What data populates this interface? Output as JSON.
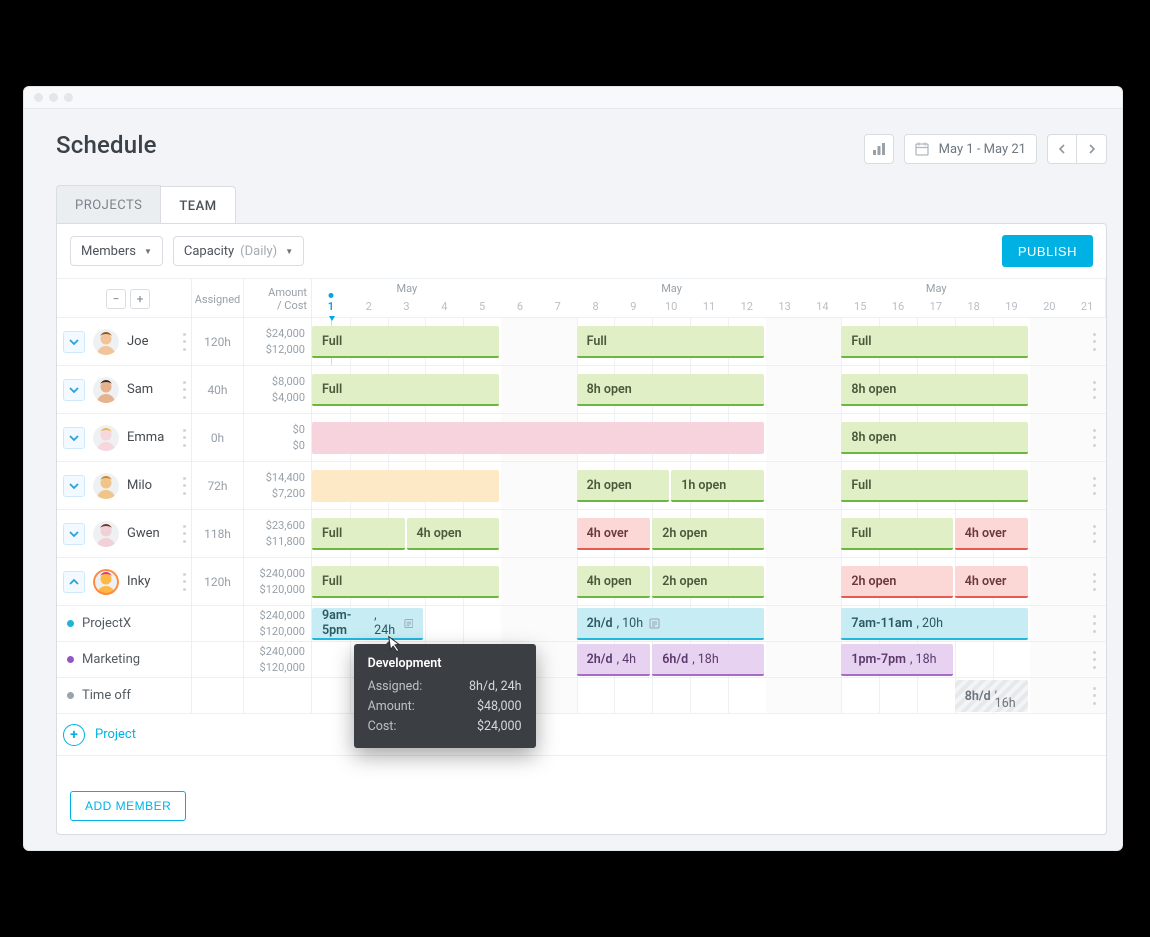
{
  "header": {
    "title": "Schedule"
  },
  "controls": {
    "date_range": "May 1 - May 21"
  },
  "tabs": {
    "projects": "PROJECTS",
    "team": "TEAM"
  },
  "filters": {
    "members_label": "Members",
    "capacity_label": "Capacity",
    "capacity_mode": "(Daily)"
  },
  "publish_label": "PUBLISH",
  "add_member_label": "ADD MEMBER",
  "add_project_label": "Project",
  "columns": {
    "assigned": "Assigned",
    "amount_cost": "Amount\n/ Cost"
  },
  "timeline": {
    "month_label": "May",
    "days": [
      1,
      2,
      3,
      4,
      5,
      6,
      7,
      8,
      9,
      10,
      11,
      12,
      13,
      14,
      15,
      16,
      17,
      18,
      19,
      20,
      21
    ],
    "today_index": 0
  },
  "members": [
    {
      "name": "Joe",
      "assigned": "120h",
      "amount": "$24,000",
      "cost": "$12,000",
      "expanded": false,
      "avatar": {
        "bg": "#f2c49a",
        "hair": "#8b5a2b"
      },
      "bars": [
        {
          "text": "Full",
          "style": "green",
          "week": 0,
          "span": 5
        },
        {
          "text": "Full",
          "style": "green",
          "week": 1,
          "span": 5
        },
        {
          "text": "Full",
          "style": "green",
          "week": 2,
          "span": 5
        }
      ]
    },
    {
      "name": "Sam",
      "assigned": "40h",
      "amount": "$8,000",
      "cost": "$4,000",
      "expanded": false,
      "avatar": {
        "bg": "#e7b28e",
        "hair": "#3a2c22"
      },
      "bars": [
        {
          "text": "Full",
          "style": "green",
          "week": 0,
          "span": 5
        },
        {
          "text": "8h open",
          "style": "green",
          "week": 1,
          "span": 5
        },
        {
          "text": "8h open",
          "style": "green",
          "week": 2,
          "span": 5
        }
      ]
    },
    {
      "name": "Emma",
      "assigned": "0h",
      "amount": "$0",
      "cost": "$0",
      "expanded": false,
      "avatar": {
        "bg": "#f7d6de",
        "hair": "#e9b94a"
      },
      "bars": [
        {
          "text": "",
          "style": "pink",
          "week": 0,
          "span": 12
        },
        {
          "text": "8h open",
          "style": "green",
          "week": 2,
          "span": 5
        }
      ]
    },
    {
      "name": "Milo",
      "assigned": "72h",
      "amount": "$14,400",
      "cost": "$7,200",
      "expanded": false,
      "avatar": {
        "bg": "#f0c58a",
        "hair": "#c8863a"
      },
      "bars": [
        {
          "text": "",
          "style": "yellow",
          "week": 0,
          "span": 5
        },
        {
          "text": "2h open",
          "style": "green",
          "week": 1,
          "span": 2.5
        },
        {
          "text": "1h open",
          "style": "green",
          "week": 1,
          "span": 2.5,
          "offset": 2.5
        },
        {
          "text": "Full",
          "style": "green",
          "week": 2,
          "span": 5
        }
      ]
    },
    {
      "name": "Gwen",
      "assigned": "118h",
      "amount": "$23,600",
      "cost": "$11,800",
      "expanded": false,
      "avatar": {
        "bg": "#f1d0d7",
        "hair": "#6b3b2a"
      },
      "bars": [
        {
          "text": "Full",
          "style": "green",
          "week": 0,
          "span": 2.5
        },
        {
          "text": "4h open",
          "style": "green",
          "week": 0,
          "span": 2.5,
          "offset": 2.5
        },
        {
          "text": "4h over",
          "style": "red",
          "week": 1,
          "span": 2
        },
        {
          "text": "2h open",
          "style": "green",
          "week": 1,
          "span": 3,
          "offset": 2
        },
        {
          "text": "Full",
          "style": "green",
          "week": 2,
          "span": 3
        },
        {
          "text": "4h over",
          "style": "red",
          "week": 2,
          "span": 2,
          "offset": 3
        }
      ]
    },
    {
      "name": "Inky",
      "assigned": "120h",
      "amount": "$240,000",
      "cost": "$120,000",
      "expanded": true,
      "avatar": {
        "bg": "#ffb746",
        "hair": "#d53a7a"
      },
      "bars": [
        {
          "text": "Full",
          "style": "green",
          "week": 0,
          "span": 5
        },
        {
          "text": "4h open",
          "style": "green",
          "week": 1,
          "span": 2
        },
        {
          "text": "2h open",
          "style": "green",
          "week": 1,
          "span": 3,
          "offset": 2
        },
        {
          "text": "2h open",
          "style": "red",
          "week": 2,
          "span": 3
        },
        {
          "text": "4h over",
          "style": "red",
          "week": 2,
          "span": 2,
          "offset": 3
        }
      ],
      "children": [
        {
          "name": "ProjectX",
          "dot": "#1bb5d8",
          "amount": "$240,000",
          "cost": "$120,000",
          "bars": [
            {
              "text": "9am-5pm, 24h",
              "style": "blue",
              "week": 0,
              "span": 3,
              "note": true
            },
            {
              "text": "2h/d, 10h",
              "style": "blue",
              "week": 1,
              "span": 5,
              "note": true
            },
            {
              "text": "7am-11am, 20h",
              "style": "blue",
              "week": 2,
              "span": 5
            }
          ]
        },
        {
          "name": "Marketing",
          "dot": "#9256c6",
          "amount": "$240,000",
          "cost": "$120,000",
          "bars": [
            {
              "text": "2h/d, 4h",
              "style": "purple",
              "week": 1,
              "span": 2
            },
            {
              "text": "6h/d, 18h",
              "style": "purple",
              "week": 1,
              "span": 3,
              "offset": 2
            },
            {
              "text": "1pm-7pm, 18h",
              "style": "purple",
              "week": 2,
              "span": 3
            }
          ]
        },
        {
          "name": "Time off",
          "dot": "#9aa4ad",
          "amount": "",
          "cost": "",
          "bars": [
            {
              "text": "8h/d, 16h",
              "style": "hatch",
              "week": 2,
              "span": 2,
              "offset": 3
            }
          ]
        }
      ]
    }
  ],
  "tooltip": {
    "title": "Development",
    "rows": [
      {
        "k": "Assigned:",
        "v": "8h/d, 24h"
      },
      {
        "k": "Amount:",
        "v": "$48,000"
      },
      {
        "k": "Cost:",
        "v": "$24,000"
      }
    ]
  }
}
